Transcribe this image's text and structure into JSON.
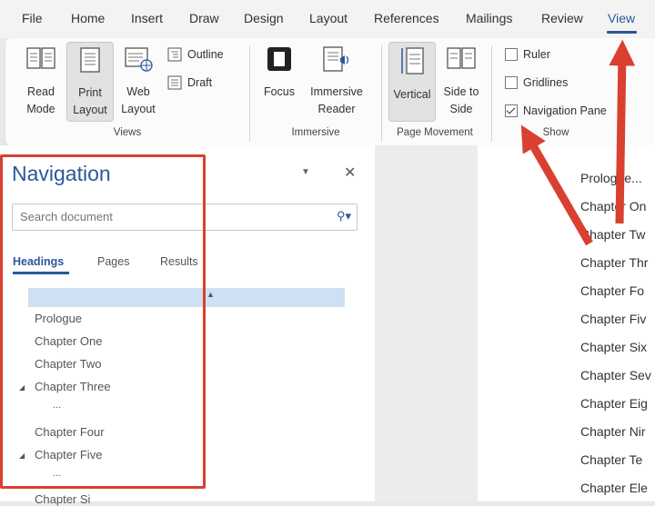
{
  "menu": {
    "items": [
      "File",
      "Home",
      "Insert",
      "Draw",
      "Design",
      "Layout",
      "References",
      "Mailings",
      "Review",
      "View"
    ],
    "active": "View"
  },
  "ribbon": {
    "views": {
      "read_mode": "Read Mode",
      "print_layout": "Print Layout",
      "web_layout": "Web Layout",
      "outline": "Outline",
      "draft": "Draft",
      "group_label": "Views"
    },
    "immersive": {
      "focus": "Focus",
      "immersive_reader": "Immersive Reader",
      "group_label": "Immersive"
    },
    "page_movement": {
      "vertical": "Vertical",
      "side_to_side": "Side to Side",
      "group_label": "Page Movement"
    },
    "show": {
      "ruler": "Ruler",
      "gridlines": "Gridlines",
      "navigation_pane": "Navigation Pane",
      "group_label": "Show",
      "ruler_checked": false,
      "gridlines_checked": false,
      "navigation_pane_checked": true
    }
  },
  "navigation": {
    "title": "Navigation",
    "search_placeholder": "Search document",
    "tabs": [
      "Headings",
      "Pages",
      "Results"
    ],
    "active_tab": "Headings",
    "headings": [
      {
        "label": "Prologue",
        "expandable": false
      },
      {
        "label": "Chapter One",
        "expandable": false
      },
      {
        "label": "Chapter Two",
        "expandable": false
      },
      {
        "label": "Chapter Three",
        "expandable": true
      },
      {
        "label": "...",
        "expandable": false
      },
      {
        "label": "Chapter Four",
        "expandable": false
      },
      {
        "label": "Chapter Five",
        "expandable": true
      },
      {
        "label": "...",
        "expandable": false
      },
      {
        "label": "Chapter Si",
        "expandable": false
      }
    ]
  },
  "document": {
    "toc": [
      "Prologue...",
      "Chapter On",
      "Chapter Tw",
      "Chapter Thr",
      "Chapter Fo",
      "Chapter Fiv",
      "Chapter Six",
      "Chapter Sev",
      "Chapter Eig",
      "Chapter Nir",
      "Chapter Te",
      "Chapter Ele"
    ]
  },
  "colors": {
    "accent": "#2b579a",
    "annotation_red": "#d9402f",
    "selection": "#cfe0f5"
  }
}
